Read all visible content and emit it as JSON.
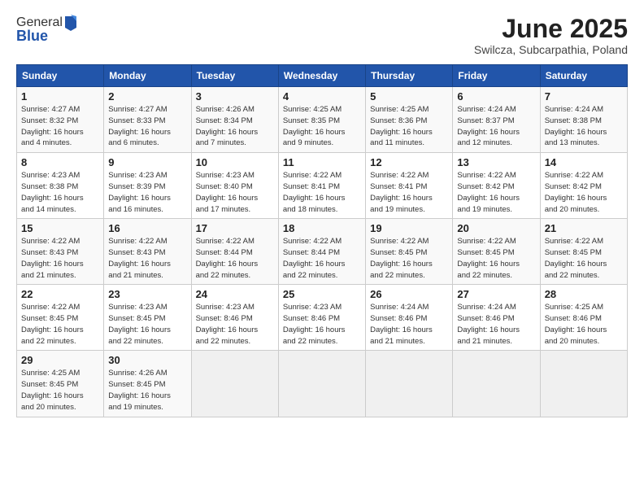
{
  "header": {
    "logo_general": "General",
    "logo_blue": "Blue",
    "title": "June 2025",
    "subtitle": "Swilcza, Subcarpathia, Poland"
  },
  "columns": [
    "Sunday",
    "Monday",
    "Tuesday",
    "Wednesday",
    "Thursday",
    "Friday",
    "Saturday"
  ],
  "weeks": [
    [
      {
        "day": "1",
        "info": "Sunrise: 4:27 AM\nSunset: 8:32 PM\nDaylight: 16 hours\nand 4 minutes."
      },
      {
        "day": "2",
        "info": "Sunrise: 4:27 AM\nSunset: 8:33 PM\nDaylight: 16 hours\nand 6 minutes."
      },
      {
        "day": "3",
        "info": "Sunrise: 4:26 AM\nSunset: 8:34 PM\nDaylight: 16 hours\nand 7 minutes."
      },
      {
        "day": "4",
        "info": "Sunrise: 4:25 AM\nSunset: 8:35 PM\nDaylight: 16 hours\nand 9 minutes."
      },
      {
        "day": "5",
        "info": "Sunrise: 4:25 AM\nSunset: 8:36 PM\nDaylight: 16 hours\nand 11 minutes."
      },
      {
        "day": "6",
        "info": "Sunrise: 4:24 AM\nSunset: 8:37 PM\nDaylight: 16 hours\nand 12 minutes."
      },
      {
        "day": "7",
        "info": "Sunrise: 4:24 AM\nSunset: 8:38 PM\nDaylight: 16 hours\nand 13 minutes."
      }
    ],
    [
      {
        "day": "8",
        "info": "Sunrise: 4:23 AM\nSunset: 8:38 PM\nDaylight: 16 hours\nand 14 minutes."
      },
      {
        "day": "9",
        "info": "Sunrise: 4:23 AM\nSunset: 8:39 PM\nDaylight: 16 hours\nand 16 minutes."
      },
      {
        "day": "10",
        "info": "Sunrise: 4:23 AM\nSunset: 8:40 PM\nDaylight: 16 hours\nand 17 minutes."
      },
      {
        "day": "11",
        "info": "Sunrise: 4:22 AM\nSunset: 8:41 PM\nDaylight: 16 hours\nand 18 minutes."
      },
      {
        "day": "12",
        "info": "Sunrise: 4:22 AM\nSunset: 8:41 PM\nDaylight: 16 hours\nand 19 minutes."
      },
      {
        "day": "13",
        "info": "Sunrise: 4:22 AM\nSunset: 8:42 PM\nDaylight: 16 hours\nand 19 minutes."
      },
      {
        "day": "14",
        "info": "Sunrise: 4:22 AM\nSunset: 8:42 PM\nDaylight: 16 hours\nand 20 minutes."
      }
    ],
    [
      {
        "day": "15",
        "info": "Sunrise: 4:22 AM\nSunset: 8:43 PM\nDaylight: 16 hours\nand 21 minutes."
      },
      {
        "day": "16",
        "info": "Sunrise: 4:22 AM\nSunset: 8:43 PM\nDaylight: 16 hours\nand 21 minutes."
      },
      {
        "day": "17",
        "info": "Sunrise: 4:22 AM\nSunset: 8:44 PM\nDaylight: 16 hours\nand 22 minutes."
      },
      {
        "day": "18",
        "info": "Sunrise: 4:22 AM\nSunset: 8:44 PM\nDaylight: 16 hours\nand 22 minutes."
      },
      {
        "day": "19",
        "info": "Sunrise: 4:22 AM\nSunset: 8:45 PM\nDaylight: 16 hours\nand 22 minutes."
      },
      {
        "day": "20",
        "info": "Sunrise: 4:22 AM\nSunset: 8:45 PM\nDaylight: 16 hours\nand 22 minutes."
      },
      {
        "day": "21",
        "info": "Sunrise: 4:22 AM\nSunset: 8:45 PM\nDaylight: 16 hours\nand 22 minutes."
      }
    ],
    [
      {
        "day": "22",
        "info": "Sunrise: 4:22 AM\nSunset: 8:45 PM\nDaylight: 16 hours\nand 22 minutes."
      },
      {
        "day": "23",
        "info": "Sunrise: 4:23 AM\nSunset: 8:45 PM\nDaylight: 16 hours\nand 22 minutes."
      },
      {
        "day": "24",
        "info": "Sunrise: 4:23 AM\nSunset: 8:46 PM\nDaylight: 16 hours\nand 22 minutes."
      },
      {
        "day": "25",
        "info": "Sunrise: 4:23 AM\nSunset: 8:46 PM\nDaylight: 16 hours\nand 22 minutes."
      },
      {
        "day": "26",
        "info": "Sunrise: 4:24 AM\nSunset: 8:46 PM\nDaylight: 16 hours\nand 21 minutes."
      },
      {
        "day": "27",
        "info": "Sunrise: 4:24 AM\nSunset: 8:46 PM\nDaylight: 16 hours\nand 21 minutes."
      },
      {
        "day": "28",
        "info": "Sunrise: 4:25 AM\nSunset: 8:46 PM\nDaylight: 16 hours\nand 20 minutes."
      }
    ],
    [
      {
        "day": "29",
        "info": "Sunrise: 4:25 AM\nSunset: 8:45 PM\nDaylight: 16 hours\nand 20 minutes."
      },
      {
        "day": "30",
        "info": "Sunrise: 4:26 AM\nSunset: 8:45 PM\nDaylight: 16 hours\nand 19 minutes."
      },
      {
        "day": "",
        "info": ""
      },
      {
        "day": "",
        "info": ""
      },
      {
        "day": "",
        "info": ""
      },
      {
        "day": "",
        "info": ""
      },
      {
        "day": "",
        "info": ""
      }
    ]
  ]
}
